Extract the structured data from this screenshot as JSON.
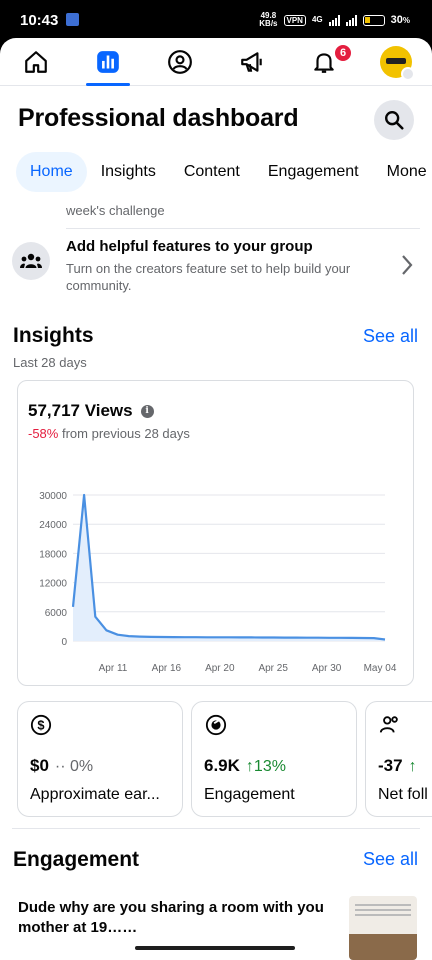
{
  "status_bar": {
    "time": "10:43",
    "net_speed": "49.8",
    "net_unit": "KB/s",
    "vpn": "VPN",
    "net_type": "4G",
    "battery": "30"
  },
  "nav": {
    "notification_count": "6"
  },
  "page": {
    "title": "Professional dashboard"
  },
  "tabs": [
    "Home",
    "Insights",
    "Content",
    "Engagement",
    "Mone"
  ],
  "partial_text": "week's challenge",
  "feature": {
    "title": "Add helpful features to your group",
    "description": "Turn on the creators feature set to help build your community."
  },
  "insights": {
    "title": "Insights",
    "see_all": "See all",
    "period": "Last 28 days",
    "views": "57,717 Views",
    "delta_pct": "-58%",
    "delta_text": "from previous 28 days"
  },
  "chart_data": {
    "type": "area",
    "x_ticks": [
      "Apr 11",
      "Apr 16",
      "Apr 20",
      "Apr 25",
      "Apr 30",
      "May 04"
    ],
    "y_ticks": [
      "30000",
      "24000",
      "18000",
      "12000",
      "6000",
      "0"
    ],
    "ylim": [
      0,
      30000
    ],
    "series": [
      {
        "values": [
          7000,
          30000,
          5000,
          2200,
          1300,
          1000,
          900,
          850,
          820,
          800,
          790,
          780,
          770,
          760,
          750,
          740,
          730,
          720,
          710,
          700,
          690,
          680,
          670,
          660,
          650,
          640,
          620,
          600,
          300
        ]
      }
    ],
    "color": "#4a90e2",
    "fill": "#e3eefc",
    "grid": true
  },
  "metrics": [
    {
      "value": "$0",
      "change": "0%",
      "change_prefix": "··",
      "label": "Approximate ear...",
      "icon": "dollar-icon"
    },
    {
      "value": "6.9K",
      "change": "13%",
      "change_prefix": "↑",
      "label": "Engagement",
      "icon": "engagement-icon"
    },
    {
      "value": "-37",
      "change": "",
      "change_prefix": "↑",
      "label": "Net foll",
      "icon": "followers-icon"
    }
  ],
  "engagement": {
    "title": "Engagement",
    "see_all": "See all",
    "post_text": "Dude why are you sharing a room with you mother at 19……"
  }
}
